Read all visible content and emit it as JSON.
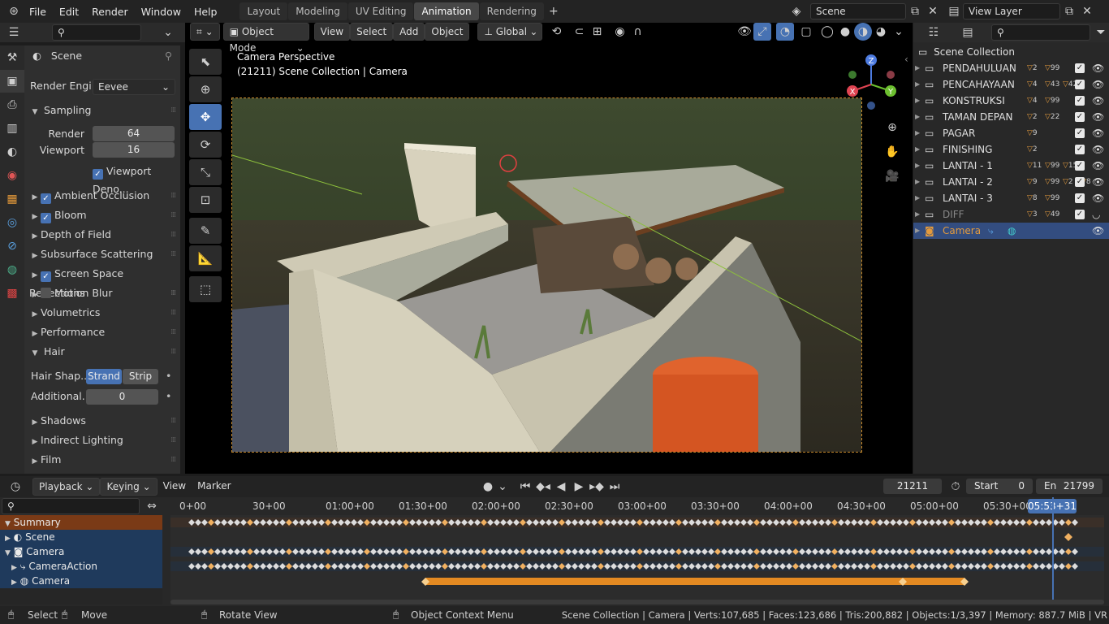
{
  "topbar": {
    "menus": [
      "File",
      "Edit",
      "Render",
      "Window",
      "Help"
    ],
    "workspaces": [
      "Layout",
      "Modeling",
      "UV Editing",
      "Animation",
      "Rendering"
    ],
    "active_workspace": "Animation",
    "scene_name": "Scene",
    "view_layer": "View Layer"
  },
  "viewport_header": {
    "mode": "Object Mode",
    "menus": [
      "View",
      "Select",
      "Add",
      "Object"
    ],
    "transform_orientation": "Global"
  },
  "viewport": {
    "overlay_line1": "Camera Perspective",
    "overlay_line2": "(21211) Scene Collection | Camera",
    "gizmo_axes": [
      "X",
      "Y",
      "Z"
    ]
  },
  "properties": {
    "header": "Scene",
    "render_engine_label": "Render Engi...",
    "render_engine": "Eevee",
    "sampling": "Sampling",
    "render_label": "Render",
    "render_value": "64",
    "viewport_label": "Viewport",
    "viewport_value": "16",
    "viewport_denoise": "Viewport Deno...",
    "sections": [
      {
        "label": "Ambient Occlusion",
        "checkbox": true,
        "checked": true
      },
      {
        "label": "Bloom",
        "checkbox": true,
        "checked": true
      },
      {
        "label": "Depth of Field",
        "checkbox": false
      },
      {
        "label": "Subsurface Scattering",
        "checkbox": false
      },
      {
        "label": "Screen Space Reflections",
        "checkbox": true,
        "checked": true
      },
      {
        "label": "Motion Blur",
        "checkbox": true,
        "checked": false
      },
      {
        "label": "Volumetrics",
        "checkbox": false
      },
      {
        "label": "Performance",
        "checkbox": false
      }
    ],
    "hair": "Hair",
    "hair_shape_label": "Hair Shap...",
    "hair_strand": "Strand",
    "hair_strip": "Strip",
    "additional_label": "Additional...",
    "additional_value": "0",
    "tail_sections": [
      "Shadows",
      "Indirect Lighting",
      "Film"
    ]
  },
  "outliner": {
    "root": "Scene Collection",
    "items": [
      {
        "label": "PENDAHULUAN",
        "badges": [
          "2",
          "99"
        ],
        "dim": false
      },
      {
        "label": "PENCAHAYAAN",
        "badges": [
          "4",
          "43",
          "42"
        ],
        "dim": false
      },
      {
        "label": "KONSTRUKSI",
        "badges": [
          "4",
          "99"
        ],
        "dim": false
      },
      {
        "label": "TAMAN DEPAN",
        "badges": [
          "2",
          "22"
        ],
        "dim": false
      },
      {
        "label": "PAGAR",
        "badges": [
          "9"
        ],
        "dim": false
      },
      {
        "label": "FINISHING",
        "badges": [
          "2"
        ],
        "dim": false
      },
      {
        "label": "LANTAI - 1",
        "badges": [
          "11",
          "99",
          "15"
        ],
        "dim": false
      },
      {
        "label": "LANTAI - 2",
        "badges": [
          "9",
          "99",
          "2",
          "8"
        ],
        "dim": false
      },
      {
        "label": "LANTAI - 3",
        "badges": [
          "8",
          "99"
        ],
        "dim": false
      },
      {
        "label": "DIFF",
        "badges": [
          "3",
          "49"
        ],
        "dim": true
      },
      {
        "label": "Camera",
        "badges": [],
        "dim": false,
        "selected": true
      }
    ]
  },
  "timeline": {
    "menus": [
      "Playback",
      "Keying",
      "View",
      "Marker"
    ],
    "current_frame": "21211",
    "start_label": "Start",
    "start_value": "0",
    "end_label": "En",
    "end_value": "21799",
    "ruler": [
      "0+00",
      "30+00",
      "01:00+00",
      "01:30+00",
      "02:00+00",
      "02:30+00",
      "03:00+00",
      "03:30+00",
      "04:00+00",
      "04:30+00",
      "05:00+00",
      "05:30+00",
      "00"
    ],
    "playhead": "05:53+31",
    "channels": [
      {
        "label": "Summary",
        "indent": 0
      },
      {
        "label": "Scene",
        "indent": 0
      },
      {
        "label": "Camera",
        "indent": 0
      },
      {
        "label": "CameraAction",
        "indent": 1
      },
      {
        "label": "Camera",
        "indent": 1
      }
    ]
  },
  "statusbar": {
    "select": "Select",
    "move": "Move",
    "rotate": "Rotate View",
    "context": "Object Context Menu",
    "stats": "Scene Collection | Camera | Verts:107,685 | Faces:123,686 | Tris:200,882 | Objects:1/3,397 | Memory: 887.7 MiB | VR"
  }
}
